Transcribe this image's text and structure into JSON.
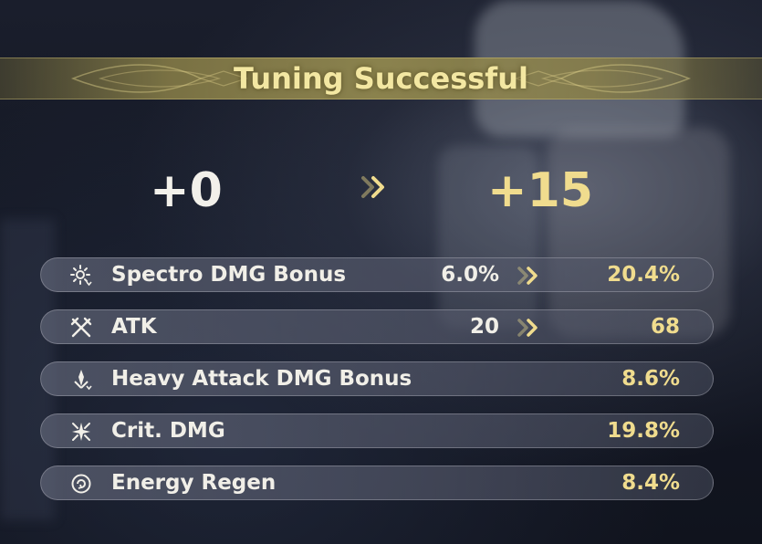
{
  "banner": {
    "title": "Tuning Successful"
  },
  "level": {
    "before": "+0",
    "after": "+15"
  },
  "stats": [
    {
      "name": "Spectro DMG Bonus",
      "before": "6.0%",
      "after": "20.4%",
      "icon": "spectro-icon"
    },
    {
      "name": "ATK",
      "before": "20",
      "after": "68",
      "icon": "atk-icon"
    },
    {
      "name": "Heavy Attack DMG Bonus",
      "before": "",
      "after": "8.6%",
      "icon": "heavy-attack-icon"
    },
    {
      "name": "Crit. DMG",
      "before": "",
      "after": "19.8%",
      "icon": "crit-dmg-icon"
    },
    {
      "name": "Energy Regen",
      "before": "",
      "after": "8.4%",
      "icon": "energy-regen-icon"
    }
  ],
  "colors": {
    "gold": "#f0dc8e",
    "white": "#f1efe8",
    "banner": "#968c50"
  }
}
